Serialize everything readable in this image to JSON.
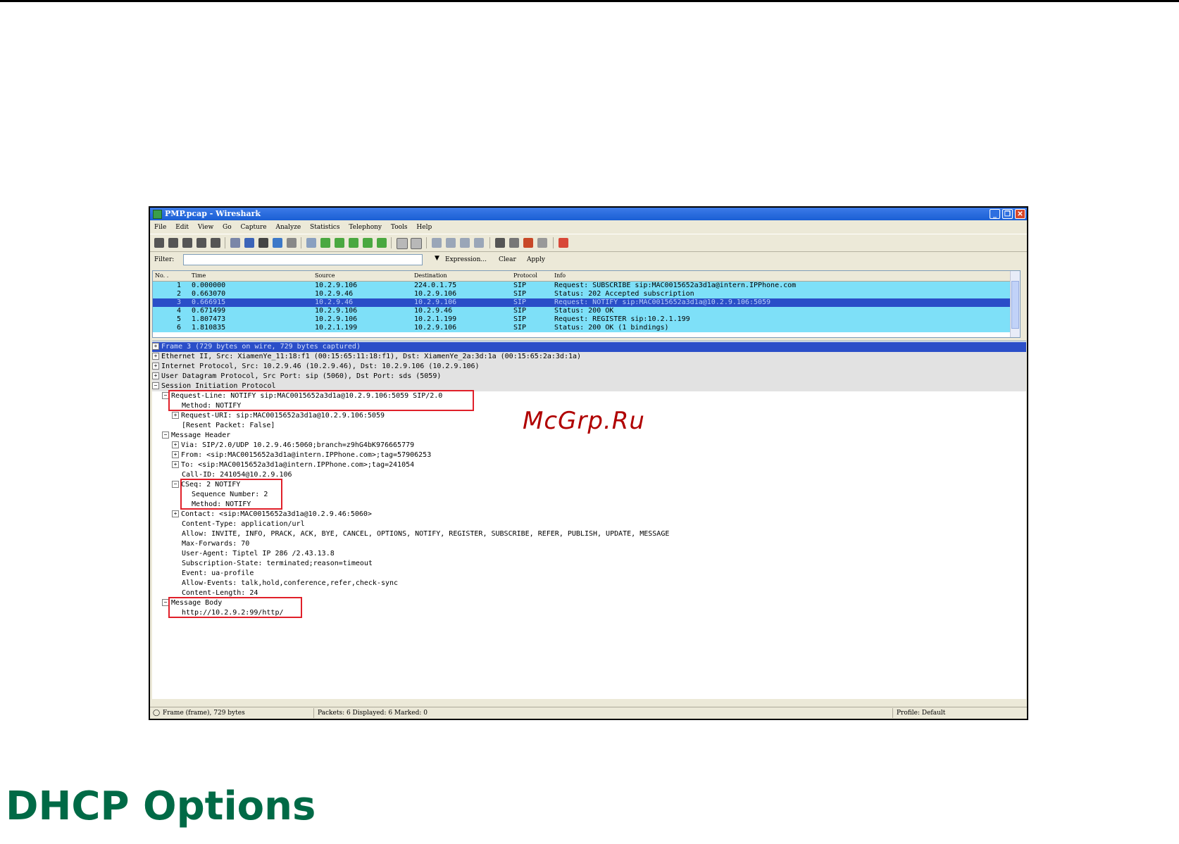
{
  "window": {
    "title": "PMP.pcap - Wireshark"
  },
  "menu": [
    "File",
    "Edit",
    "View",
    "Go",
    "Capture",
    "Analyze",
    "Statistics",
    "Telephony",
    "Tools",
    "Help"
  ],
  "filter": {
    "label": "Filter:",
    "value": "",
    "expression": "Expression...",
    "clear": "Clear",
    "apply": "Apply"
  },
  "packet_list": {
    "columns": [
      "No. .",
      "Time",
      "Source",
      "Destination",
      "Protocol",
      "Info"
    ],
    "rows": [
      {
        "no": "1",
        "time": "0.000000",
        "source": "10.2.9.106",
        "destination": "224.0.1.75",
        "protocol": "SIP",
        "info": "Request: SUBSCRIBE sip:MAC0015652a3d1a@intern.IPPhone.com"
      },
      {
        "no": "2",
        "time": "0.663070",
        "source": "10.2.9.46",
        "destination": "10.2.9.106",
        "protocol": "SIP",
        "info": "Status: 202 Accepted subscription"
      },
      {
        "no": "3",
        "time": "0.666915",
        "source": "10.2.9.46",
        "destination": "10.2.9.106",
        "protocol": "SIP",
        "info": "Request: NOTIFY sip:MAC0015652a3d1a@10.2.9.106:5059"
      },
      {
        "no": "4",
        "time": "0.671499",
        "source": "10.2.9.106",
        "destination": "10.2.9.46",
        "protocol": "SIP",
        "info": "Status: 200 OK"
      },
      {
        "no": "5",
        "time": "1.807473",
        "source": "10.2.9.106",
        "destination": "10.2.1.199",
        "protocol": "SIP",
        "info": "Request: REGISTER sip:10.2.1.199"
      },
      {
        "no": "6",
        "time": "1.810835",
        "source": "10.2.1.199",
        "destination": "10.2.9.106",
        "protocol": "SIP",
        "info": "Status: 200 OK    (1 bindings)"
      }
    ]
  },
  "details": {
    "frame": "Frame 3 (729 bytes on wire, 729 bytes captured)",
    "ethernet": "Ethernet II, Src: XiamenYe_11:18:f1 (00:15:65:11:18:f1), Dst: XiamenYe_2a:3d:1a (00:15:65:2a:3d:1a)",
    "ip": "Internet Protocol, Src: 10.2.9.46 (10.2.9.46), Dst: 10.2.9.106 (10.2.9.106)",
    "udp": "User Datagram Protocol, Src Port: sip (5060), Dst Port: sds (5059)",
    "sip": "Session Initiation Protocol",
    "request_line": "Request-Line: NOTIFY sip:MAC0015652a3d1a@10.2.9.106:5059 SIP/2.0",
    "method": "Method: NOTIFY",
    "request_uri": "Request-URI: sip:MAC0015652a3d1a@10.2.9.106:5059",
    "resent": "[Resent Packet: False]",
    "message_header": "Message Header",
    "via": "Via: SIP/2.0/UDP 10.2.9.46:5060;branch=z9hG4bK976665779",
    "from": "From: <sip:MAC0015652a3d1a@intern.IPPhone.com>;tag=57906253",
    "to": "To: <sip:MAC0015652a3d1a@intern.IPPhone.com>;tag=241054",
    "call_id": "Call-ID: 241054@10.2.9.106",
    "cseq": "CSeq: 2 NOTIFY",
    "sequence_number": "Sequence Number: 2",
    "cseq_method": "Method: NOTIFY",
    "contact": "Contact: <sip:MAC0015652a3d1a@10.2.9.46:5060>",
    "content_type": "Content-Type: application/url",
    "allow": "Allow: INVITE, INFO, PRACK, ACK, BYE, CANCEL, OPTIONS, NOTIFY, REGISTER, SUBSCRIBE, REFER, PUBLISH, UPDATE, MESSAGE",
    "max_forwards": "Max-Forwards: 70",
    "user_agent": "User-Agent: Tiptel IP 286 /2.43.13.8",
    "subscription_state": "Subscription-State: terminated;reason=timeout",
    "event": "Event: ua-profile",
    "allow_events": "Allow-Events: talk,hold,conference,refer,check-sync",
    "content_length": "Content-Length: 24",
    "message_body": "Message Body",
    "body_url": "http://10.2.9.2:99/http/"
  },
  "status": {
    "frame": "Frame (frame), 729 bytes",
    "packets": "Packets: 6 Displayed: 6 Marked: 0",
    "profile": "Profile: Default"
  },
  "watermark": "McGrp.Ru",
  "section_title": "DHCP Options",
  "colors": {
    "row_bg": "#7ee0f8",
    "selected": "#2a4ec8",
    "highlight_box": "#e0202a",
    "title_green": "#006a46"
  }
}
